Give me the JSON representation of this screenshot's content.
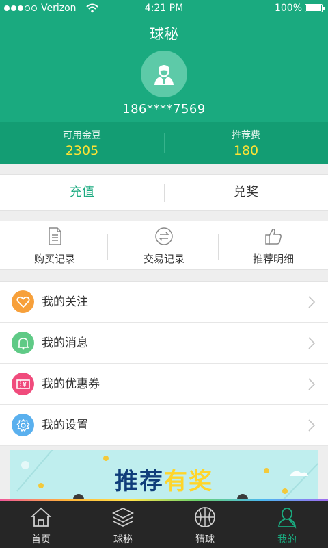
{
  "status_bar": {
    "carrier": "Verizon",
    "time": "4:21 PM",
    "battery": "100%"
  },
  "header": {
    "title": "球秘",
    "phone": "186****7569"
  },
  "balances": [
    {
      "label": "可用金豆",
      "value": "2305"
    },
    {
      "label": "推荐费",
      "value": "180"
    }
  ],
  "actions": {
    "recharge": "充值",
    "redeem": "兑奖"
  },
  "records": [
    {
      "label": "购买记录",
      "icon": "document-icon"
    },
    {
      "label": "交易记录",
      "icon": "exchange-icon"
    },
    {
      "label": "推荐明细",
      "icon": "thumbs-up-icon"
    }
  ],
  "menu": [
    {
      "label": "我的关注",
      "icon": "heart-icon",
      "color": "#f7a03a"
    },
    {
      "label": "我的消息",
      "icon": "bell-icon",
      "color": "#5fca86"
    },
    {
      "label": "我的优惠券",
      "icon": "coupon-icon",
      "color": "#f04b7c"
    },
    {
      "label": "我的设置",
      "icon": "gear-icon",
      "color": "#5ab0ee"
    }
  ],
  "banner": {
    "text_part1": "推荐",
    "text_part2": "有奖"
  },
  "tabs": [
    {
      "label": "首页",
      "icon": "home-icon"
    },
    {
      "label": "球秘",
      "icon": "layers-icon"
    },
    {
      "label": "猜球",
      "icon": "basketball-icon"
    },
    {
      "label": "我的",
      "icon": "user-icon",
      "active": true
    }
  ],
  "colors": {
    "primary": "#1aaa7f",
    "balance_value": "#ffe234",
    "tab_bar": "#262626"
  }
}
